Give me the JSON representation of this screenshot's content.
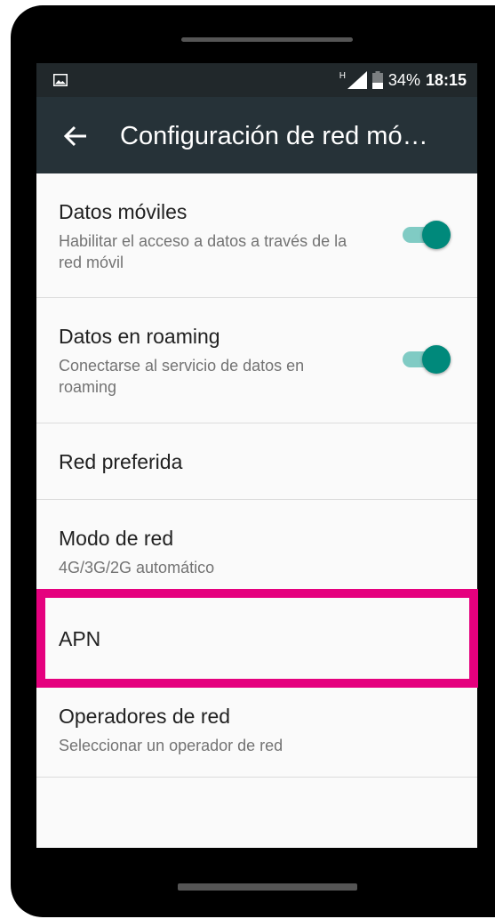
{
  "status_bar": {
    "network_type": "H",
    "battery_percent": "34%",
    "time": "18:15"
  },
  "app_bar": {
    "title": "Configuración de red mó…",
    "back_icon": "arrow-back-icon"
  },
  "settings": [
    {
      "title": "Datos móviles",
      "subtitle": "Habilitar el acceso a datos a través de la red móvil",
      "toggle_on": true
    },
    {
      "title": "Datos en roaming",
      "subtitle": "Conectarse al servicio de datos en roaming",
      "toggle_on": true
    },
    {
      "title": "Red preferida"
    },
    {
      "title": "Modo de red",
      "subtitle": "4G/3G/2G automático"
    },
    {
      "title": "APN",
      "highlighted": true
    },
    {
      "title": "Operadores de red",
      "subtitle": "Seleccionar un operador de red"
    }
  ],
  "colors": {
    "status_bar": "#21282b",
    "app_bar": "#263238",
    "toggle_on": "#00897b",
    "highlight": "#e5007e"
  }
}
